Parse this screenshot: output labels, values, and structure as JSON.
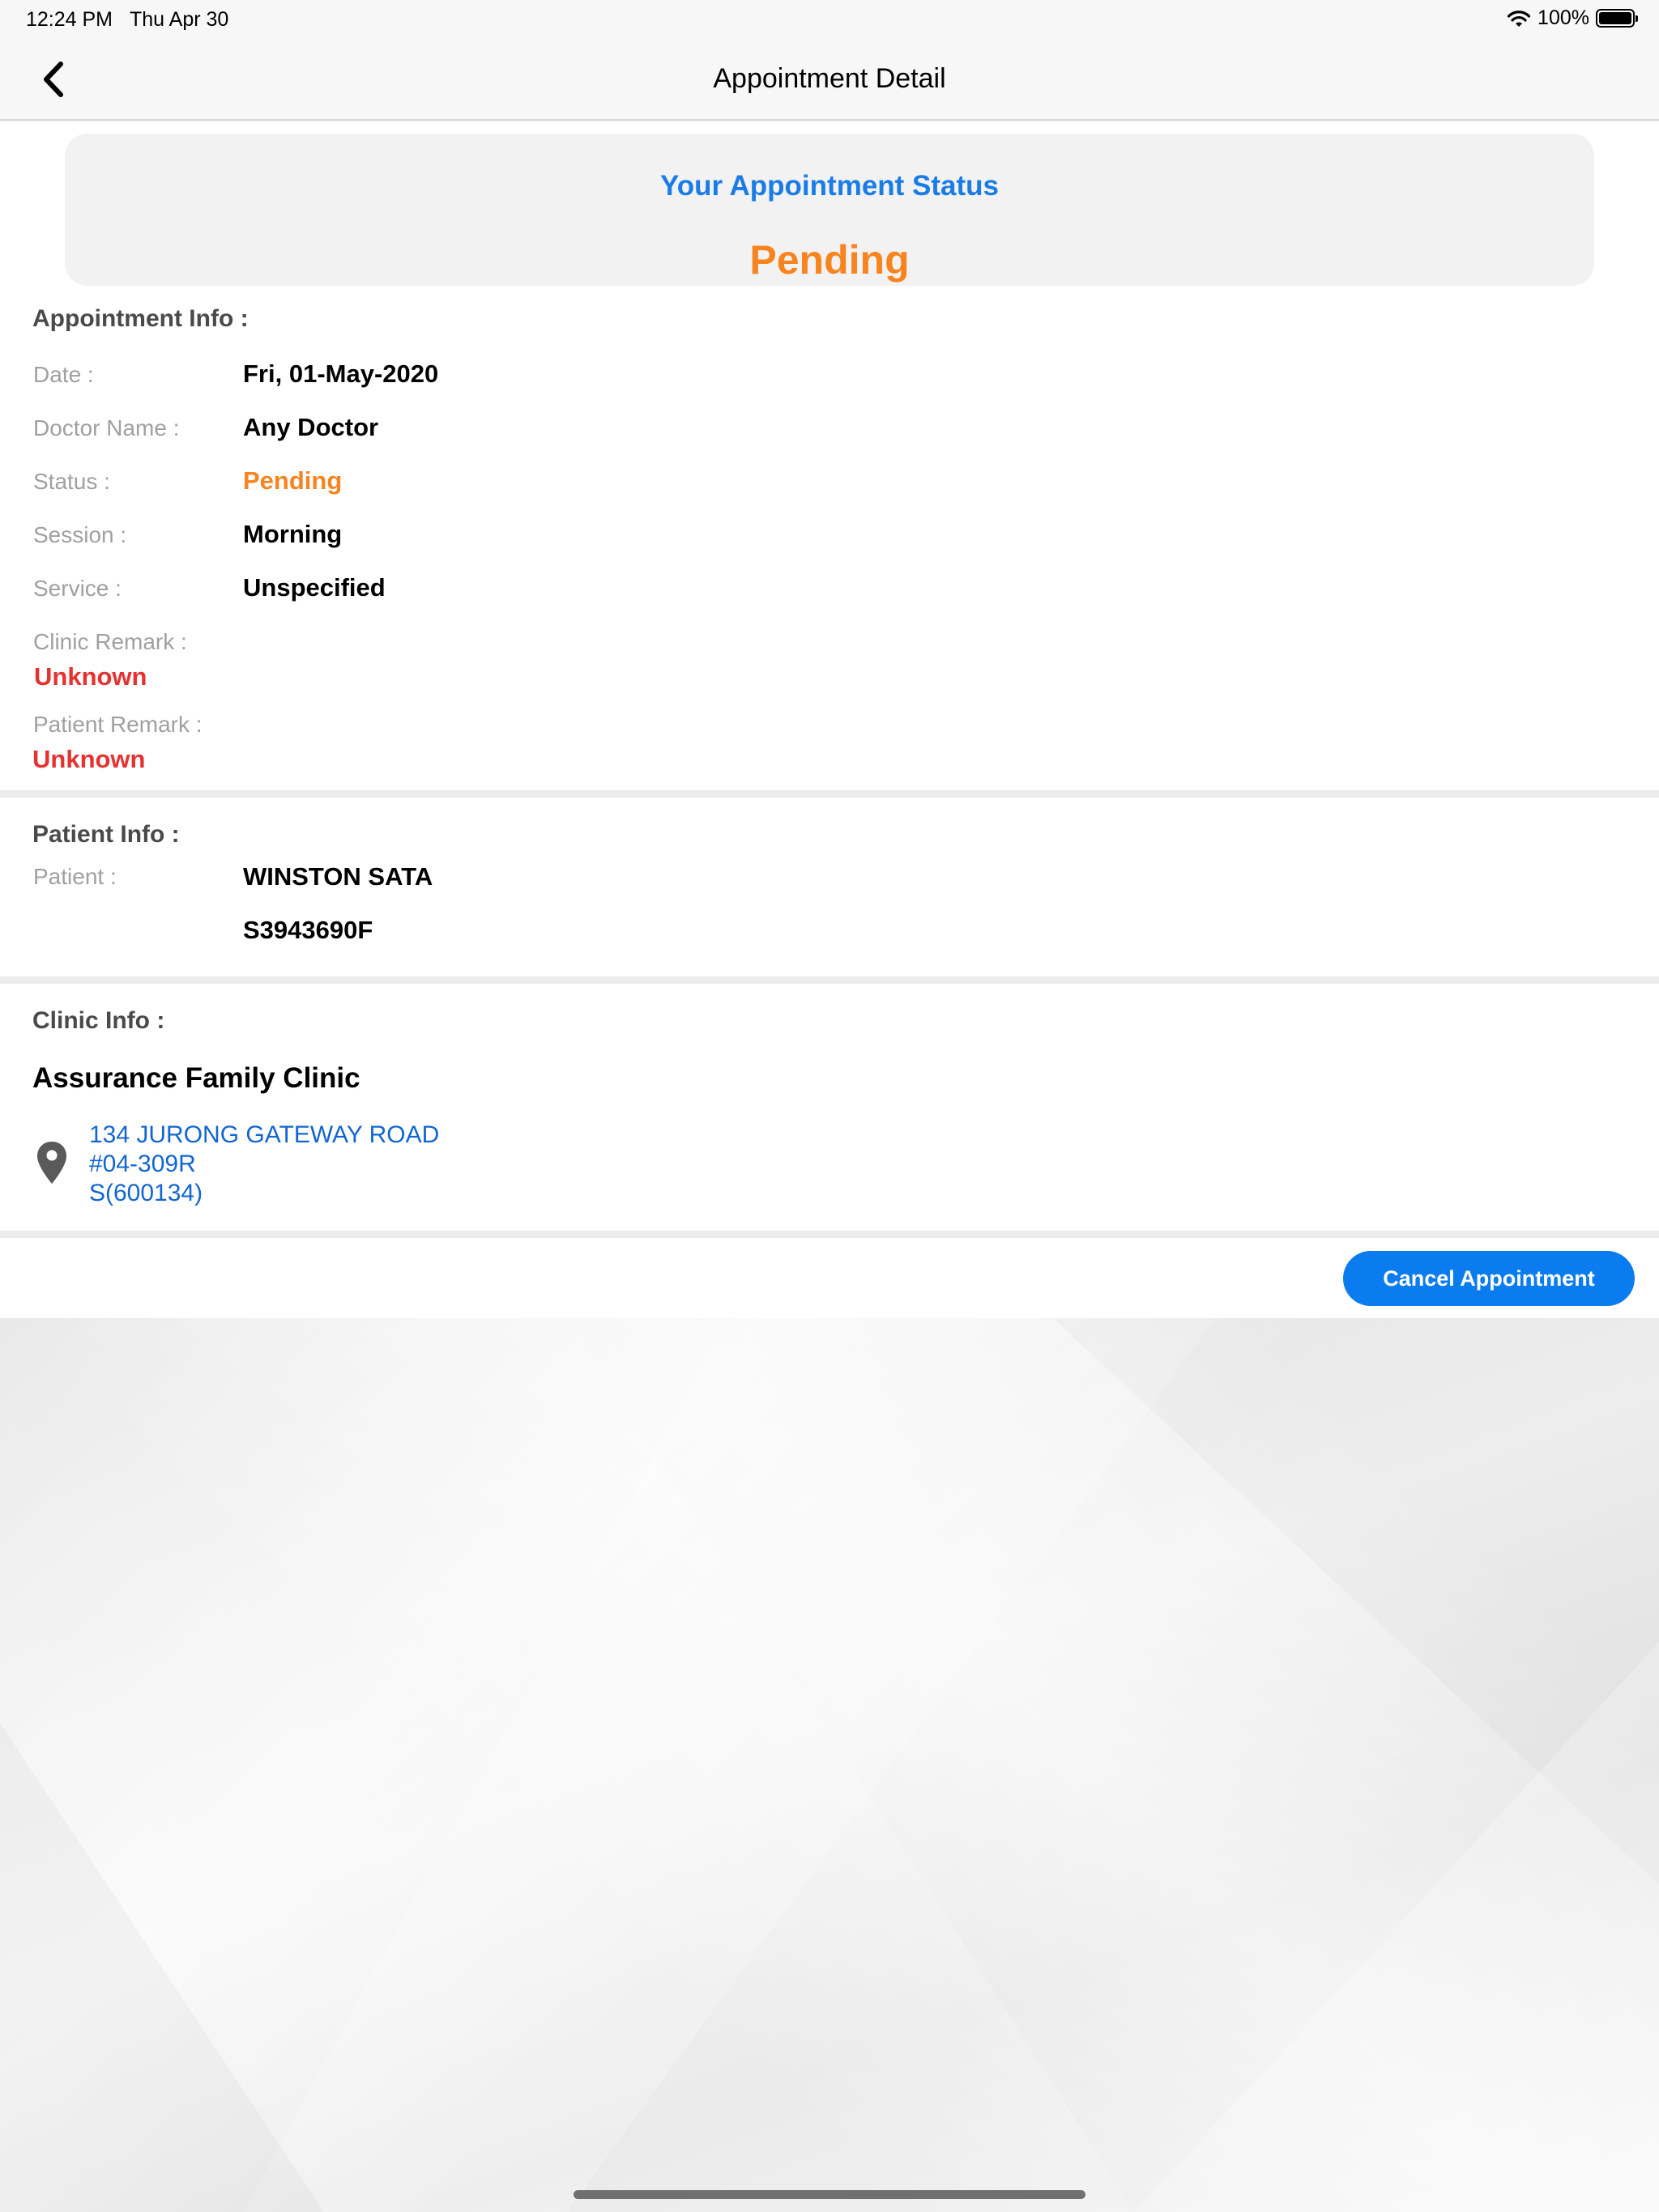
{
  "status_bar": {
    "time": "12:24 PM",
    "date": "Thu Apr 30",
    "battery": "100%"
  },
  "nav": {
    "title": "Appointment Detail"
  },
  "status_card": {
    "title": "Your Appointment Status",
    "value": "Pending"
  },
  "appointment_info": {
    "title": "Appointment Info :",
    "date_label": "Date :",
    "date_value": "Fri, 01-May-2020",
    "doctor_label": "Doctor Name :",
    "doctor_value": "Any Doctor",
    "status_label": "Status :",
    "status_value": "Pending",
    "session_label": "Session :",
    "session_value": "Morning",
    "service_label": "Service :",
    "service_value": "Unspecified",
    "clinic_remark_label": "Clinic Remark :",
    "clinic_remark_value": "Unknown",
    "patient_remark_label": "Patient Remark :",
    "patient_remark_value": "Unknown"
  },
  "patient_info": {
    "title": "Patient Info :",
    "patient_label": "Patient :",
    "patient_name": "WINSTON SATA",
    "patient_id": "S3943690F"
  },
  "clinic_info": {
    "title": "Clinic Info :",
    "name": "Assurance Family Clinic",
    "address_line1": "134 JURONG GATEWAY ROAD",
    "address_line2": "#04-309R",
    "address_line3": "S(600134)"
  },
  "actions": {
    "cancel_label": "Cancel Appointment"
  },
  "colors": {
    "accent_blue": "#1a7ce6",
    "pending_orange": "#f7841e",
    "remark_red": "#e53230",
    "button_blue": "#0b7cf0"
  }
}
